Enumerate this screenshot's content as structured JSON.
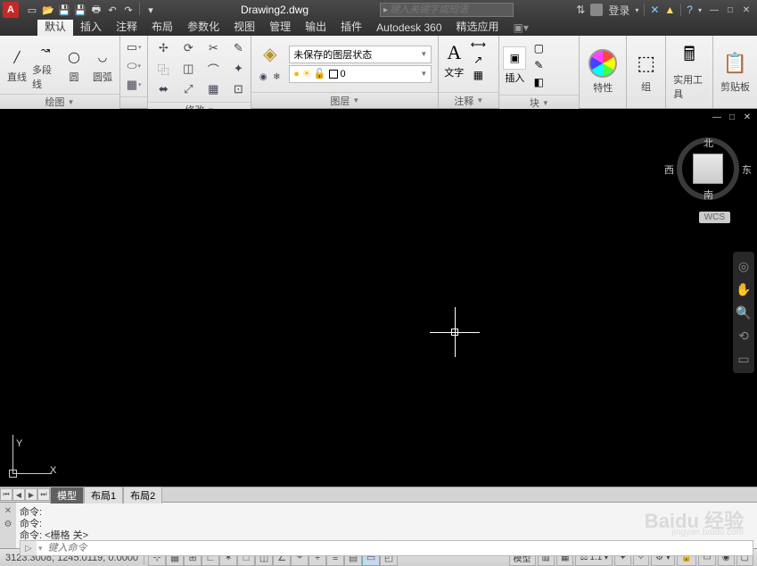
{
  "title": "Drawing2.dwg",
  "search_placeholder": "键入关键字或短语",
  "login_label": "登录",
  "menu": {
    "tabs": [
      "默认",
      "插入",
      "注释",
      "布局",
      "参数化",
      "视图",
      "管理",
      "输出",
      "插件",
      "Autodesk 360",
      "精选应用"
    ],
    "active": 0
  },
  "ribbon": {
    "draw": {
      "title": "绘图",
      "tools": [
        {
          "label": "直线",
          "name": "line-tool"
        },
        {
          "label": "多段线",
          "name": "polyline-tool"
        },
        {
          "label": "圆",
          "name": "circle-tool"
        },
        {
          "label": "圆弧",
          "name": "arc-tool"
        }
      ]
    },
    "modify": {
      "title": "修改"
    },
    "layer": {
      "title": "图层",
      "state_label": "未保存的图层状态",
      "current": "0"
    },
    "annotate": {
      "title": "注释",
      "text_label": "文字"
    },
    "block": {
      "title": "块",
      "insert_label": "插入"
    },
    "properties": {
      "title": "特性"
    },
    "group": {
      "title": "组"
    },
    "utilities": {
      "title": "实用工具"
    },
    "clipboard": {
      "title": "剪贴板"
    }
  },
  "viewcube": {
    "n": "北",
    "s": "南",
    "e": "东",
    "w": "西",
    "wcs": "WCS"
  },
  "ucs": {
    "x": "X",
    "y": "Y"
  },
  "layout_tabs": [
    "模型",
    "布局1",
    "布局2"
  ],
  "cmd": {
    "prompt": "命令:",
    "history": [
      "命令:",
      "命令:",
      "命令:  <栅格 关>"
    ],
    "placeholder": "键入命令"
  },
  "status": {
    "coords": "3123.3008, 1245.0119, 0.0000",
    "model": "模型",
    "scale": "1:1"
  },
  "watermark": "Baidu 经验",
  "watermark_sub": "jingyan.baidu.com"
}
